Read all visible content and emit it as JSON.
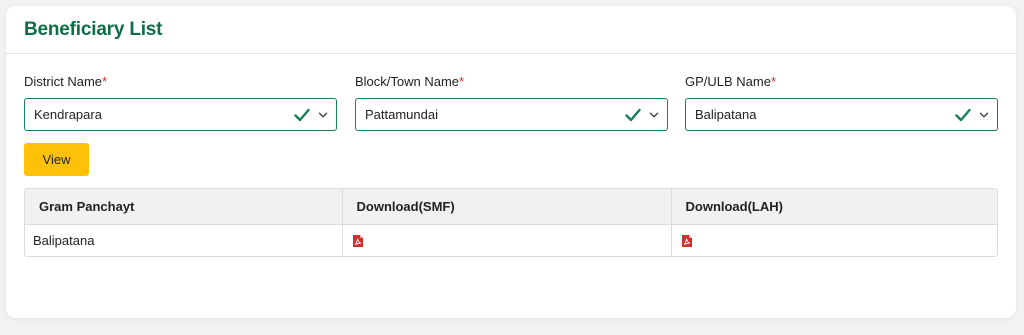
{
  "page": {
    "title": "Beneficiary List"
  },
  "colors": {
    "accent": "#0f6d48",
    "button": "#ffc107",
    "border": "#1a7f56",
    "required": "#d62828",
    "pdf": "#d32f2f"
  },
  "filters": [
    {
      "label": "District Name",
      "required_mark": "*",
      "value": "Kendrapara",
      "status_icon": "check-icon",
      "dropdown_icon": "chevron-down-icon"
    },
    {
      "label": "Block/Town Name",
      "required_mark": "*",
      "value": "Pattamundai",
      "status_icon": "check-icon",
      "dropdown_icon": "chevron-down-icon"
    },
    {
      "label": "GP/ULB Name",
      "required_mark": "*",
      "value": "Balipatana",
      "status_icon": "check-icon",
      "dropdown_icon": "chevron-down-icon"
    }
  ],
  "view_button": {
    "label": "View"
  },
  "table": {
    "headers": [
      "Gram Panchayt",
      "Download(SMF)",
      "Download(LAH)"
    ],
    "rows": [
      {
        "gram_panchayat": "Balipatana",
        "smf_icon": "pdf-icon",
        "lah_icon": "pdf-icon"
      }
    ]
  }
}
